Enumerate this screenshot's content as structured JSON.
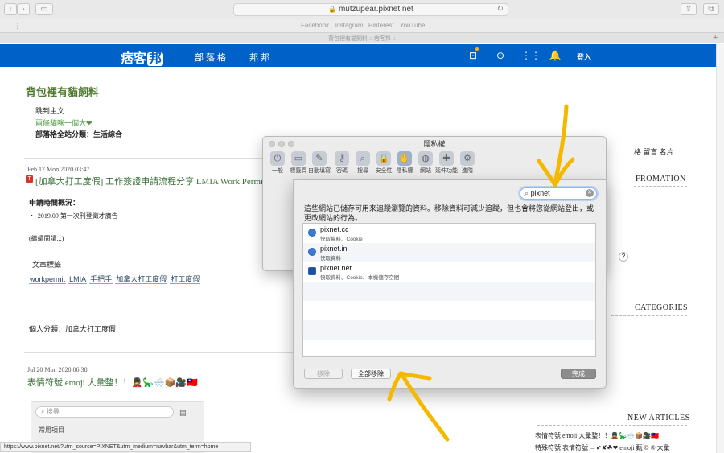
{
  "browser": {
    "url": "mutzupear.pixnet.net",
    "favorites": [
      "Facebook",
      "Instagram",
      "Pinterest",
      "YouTube"
    ],
    "tab_title": "背包裡有貓飼料 :: 痞客邦 ::",
    "status_url": "https://www.pixnet.net/?utm_source=PIXNET&utm_medium=navbar&utm_term=home"
  },
  "navbar": {
    "logo": "痞客",
    "logo_mark": "邦",
    "links": [
      "部落格",
      "邦邦"
    ],
    "login": "登入"
  },
  "blog": {
    "title": "背包裡有貓飼料",
    "skip": "跳到主文",
    "subtitle": "兩條貓咪一個大❤",
    "category": "部落格全站分類：生活綜合",
    "side_links": "格  留言  名片",
    "post1": {
      "date": "Feb 17 Mon 2020 03:47",
      "title": "[加拿大打工度假] 工作簽證申請流程分享 LMIA Work Permit 圖文",
      "section": "申請時間概況：",
      "bullet": "2019.09 第一次刊登徵才廣告",
      "more": "(繼續閱讀...)",
      "tags_label": "文章標籤",
      "tags": [
        "workpermit",
        "LMIA",
        "手把手",
        "加拿大打工度假",
        "打工度假"
      ],
      "personal_cat": "個人分類：加拿大打工度假"
    },
    "post2": {
      "date": "Jul 20 Mon 2020 06:38",
      "title": "表情符號 emoji 大彙整！！💂🦕🌨️📦🎥🇹🇼"
    },
    "sidebar": {
      "info_head": "FROMATION",
      "categories_head": "CATEGORIES",
      "new_articles_head": "NEW ARTICLES",
      "articles": [
        "表情符號 emoji 大彙整！！💂🦕🌨️📦🎥🇹🇼",
        "特殊符號 表情符號 →✔✘☘❤ emoji 甄 © ® 大彙"
      ]
    },
    "emoji_widget": {
      "search_placeholder": "搜尋",
      "section": "常用項目"
    }
  },
  "prefs": {
    "title": "隱私權",
    "tabs": [
      {
        "label": "一般",
        "icon": "switch-icon"
      },
      {
        "label": "標籤頁",
        "icon": "tabs-icon"
      },
      {
        "label": "自動填寫",
        "icon": "pencil-icon"
      },
      {
        "label": "密碼",
        "icon": "key-icon"
      },
      {
        "label": "搜尋",
        "icon": "search-icon"
      },
      {
        "label": "安全性",
        "icon": "lock-icon"
      },
      {
        "label": "隱私權",
        "icon": "hand-icon"
      },
      {
        "label": "網站",
        "icon": "globe-icon"
      },
      {
        "label": "延伸功能",
        "icon": "puzzle-icon"
      },
      {
        "label": "進階",
        "icon": "gear-icon"
      }
    ],
    "help": "?"
  },
  "sheet": {
    "search_value": "pixnet",
    "description": "這些網站已儲存可用來追蹤瀏覽的資料。移除資料可減少追蹤，但也會將您從網站登出，或更改網站的行為。",
    "sites": [
      {
        "name": "pixnet.cc",
        "data": "快取資料、Cookie"
      },
      {
        "name": "pixnet.in",
        "data": "快取資料"
      },
      {
        "name": "pixnet.net",
        "data": "快取資料、Cookie、本機儲存空間"
      }
    ],
    "remove_label": "移除",
    "remove_all_label": "全部移除",
    "done_label": "完成"
  },
  "colors": {
    "navbar": "#0062c9",
    "annotation_arrow": "#f5b800"
  }
}
